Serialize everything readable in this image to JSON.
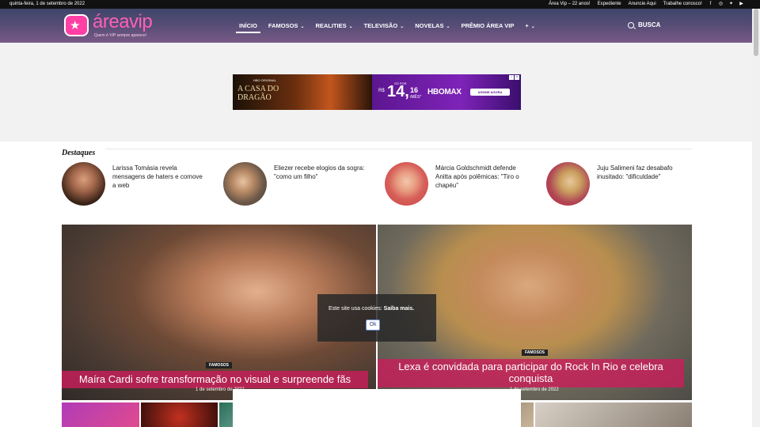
{
  "topbar": {
    "date": "quinta-feira, 1 de setembro de 2022",
    "links": [
      "Área Vip – 22 anos!",
      "Expediente",
      "Anuncie Aqui",
      "Trabalhe conosco!"
    ],
    "social_icons": [
      "facebook-icon",
      "instagram-icon",
      "twitter-icon",
      "youtube-icon"
    ]
  },
  "header": {
    "logo_name": "áreavip",
    "logo_tagline": "Quem é VIP sempre aparece!",
    "nav": [
      {
        "label": "INÍCIO",
        "dropdown": false,
        "active": true
      },
      {
        "label": "FAMOSOS",
        "dropdown": true
      },
      {
        "label": "REALITIES",
        "dropdown": true
      },
      {
        "label": "TELEVISÃO",
        "dropdown": true
      },
      {
        "label": "NOVELAS",
        "dropdown": true
      },
      {
        "label": "PRÊMIO ÁREA VIP",
        "dropdown": false
      },
      {
        "label": "+",
        "dropdown": true
      }
    ],
    "search_label": "BUSCA"
  },
  "ad": {
    "brand_small": "HBO ORIGINAL",
    "title_line1": "A CASA DO",
    "title_line2": "DRAGÃO",
    "so_por": "SÓ POR",
    "currency": "R$",
    "price": "14,",
    "cents": "16",
    "per": "/MÊS*",
    "service": "HBOMAX",
    "cta": "ASSINE AGORA"
  },
  "destaques": {
    "heading": "Destaques",
    "items": [
      {
        "title": "Larissa Tomásia revela mensagens de haters e comove a web"
      },
      {
        "title": "Eliezer recebe elogios da sogra: \"como um filho\""
      },
      {
        "title": "Márcia Goldschmidt defende Anitta após polêmicas: \"Tiro o chapéu\""
      },
      {
        "title": "Juju Salimeni faz desabafo inusitado: \"dificuldade\""
      }
    ]
  },
  "featured": [
    {
      "category": "FAMOSOS",
      "title": "Maíra Cardi sofre transformação no visual e surpreende fãs",
      "date": "1 de setembro de 2022"
    },
    {
      "category": "FAMOSOS",
      "title": "Lexa é convidada para participar do Rock In Rio e celebra conquista",
      "date": "1 de setembro de 2022"
    }
  ],
  "cookie": {
    "message": "Este site usa cookies:",
    "link": "Saiba mais.",
    "ok": "Ok"
  }
}
